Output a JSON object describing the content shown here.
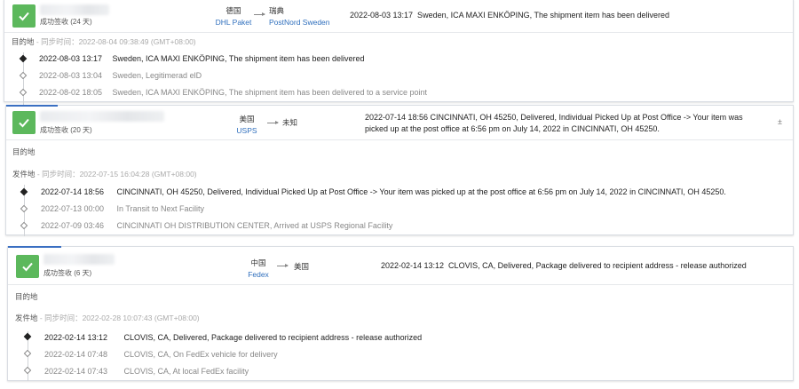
{
  "shipments": [
    {
      "status": "成功签收 (24 天)",
      "origin_country": "德国",
      "origin_carrier": "DHL Paket",
      "dest_country": "瑞典",
      "dest_carrier": "PostNord Sweden",
      "latest": "2022-08-03 13:17  Sweden, ICA MAXI ENKÖPING, The shipment item has been delivered",
      "destination_label": "目的地",
      "destination_sync": " - 同步时间：2022-08-04 09:38:49 (GMT+08:00)",
      "events": [
        {
          "time": "2022-08-03 13:17",
          "desc": "Sweden, ICA MAXI ENKÖPING, The shipment item has been delivered"
        },
        {
          "time": "2022-08-03 13:04",
          "desc": "Sweden, Legitimerad elD"
        },
        {
          "time": "2022-08-02 18:05",
          "desc": "Sweden, ICA MAXI ENKÖPING, The shipment item has been delivered to a service point"
        }
      ]
    },
    {
      "status": "成功签收 (20 天)",
      "origin_country": "美国",
      "origin_carrier": "USPS",
      "dest_country": "未知",
      "latest": "2022-07-14 18:56  CINCINNATI, OH 45250, Delivered, Individual Picked Up at Post Office -> Your item was picked up at the post office at 6:56 pm on July 14, 2022 in CINCINNATI, OH 45250.",
      "destination_label": "目的地",
      "origin_label": "发件地",
      "origin_sync": " - 同步时间：2022-07-15 16:04:28 (GMT+08:00)",
      "events": [
        {
          "time": "2022-07-14 18:56",
          "desc": "CINCINNATI, OH 45250, Delivered, Individual Picked Up at Post Office -> Your item was picked up at the post office at 6:56 pm on July 14, 2022 in CINCINNATI, OH 45250."
        },
        {
          "time": "2022-07-13 00:00",
          "desc": "In Transit to Next Facility"
        },
        {
          "time": "2022-07-09 03:46",
          "desc": "CINCINNATI OH DISTRIBUTION CENTER, Arrived at USPS Regional Facility"
        }
      ]
    },
    {
      "status": "成功签收 (6 天)",
      "origin_country": "中国",
      "origin_carrier": "Fedex",
      "dest_country": "美国",
      "latest": "2022-02-14 13:12  CLOVIS, CA, Delivered, Package delivered to recipient address - release authorized",
      "destination_label": "目的地",
      "origin_label": "发件地",
      "origin_sync": " - 同步时间：2022-02-28 10:07:43 (GMT+08:00)",
      "events": [
        {
          "time": "2022-02-14 13:12",
          "desc": "CLOVIS, CA, Delivered, Package delivered to recipient address - release authorized"
        },
        {
          "time": "2022-02-14 07:48",
          "desc": "CLOVIS, CA, On FedEx vehicle for delivery"
        },
        {
          "time": "2022-02-14 07:43",
          "desc": "CLOVIS, CA, At local FedEx facility"
        }
      ]
    }
  ],
  "expand_icon_glyph": "±",
  "colors": {
    "success": "#5cb85c",
    "carrier_link": "#2f6fbd",
    "accent": "#3a6fc2"
  }
}
